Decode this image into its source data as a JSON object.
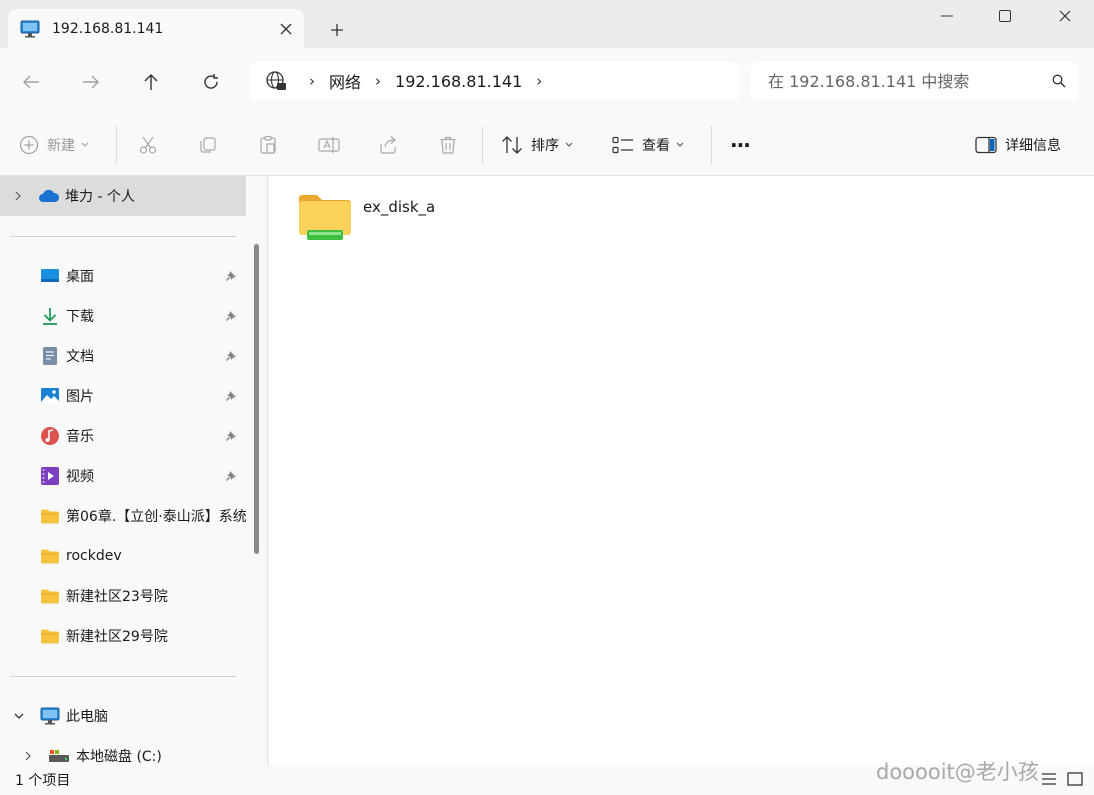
{
  "tab": {
    "title": "192.168.81.141"
  },
  "address": {
    "crumbs": [
      "网络",
      "192.168.81.141"
    ]
  },
  "search": {
    "placeholder": "在 192.168.81.141 中搜索"
  },
  "commands": {
    "new_label": "新建",
    "sort_label": "排序",
    "view_label": "查看",
    "more_label": "···",
    "details_label": "详细信息"
  },
  "sidebar": {
    "onedrive": "堆力 - 个人",
    "quick_access": [
      {
        "label": "桌面",
        "icon": "desktop-icon",
        "pinned": true
      },
      {
        "label": "下载",
        "icon": "download-icon",
        "pinned": true
      },
      {
        "label": "文档",
        "icon": "document-icon",
        "pinned": true
      },
      {
        "label": "图片",
        "icon": "picture-icon",
        "pinned": true
      },
      {
        "label": "音乐",
        "icon": "music-icon",
        "pinned": true
      },
      {
        "label": "视频",
        "icon": "video-icon",
        "pinned": true
      },
      {
        "label": "第06章.【立创·泰山派】系统",
        "icon": "folder-icon",
        "pinned": false
      },
      {
        "label": "rockdev",
        "icon": "folder-icon",
        "pinned": false
      },
      {
        "label": "新建社区23号院",
        "icon": "folder-icon",
        "pinned": false
      },
      {
        "label": "新建社区29号院",
        "icon": "folder-icon",
        "pinned": false
      }
    ],
    "this_pc": "此电脑",
    "local_disk": "本地磁盘 (C:)"
  },
  "content": {
    "items": [
      {
        "name": "ex_disk_a",
        "icon": "network-folder-icon"
      }
    ]
  },
  "status": {
    "count": "1 个项目"
  },
  "watermark": "dooooit@老小孩",
  "colors": {
    "accent": "#0067c0",
    "folder": "#f8c440",
    "selected": "#dcdcdc"
  }
}
